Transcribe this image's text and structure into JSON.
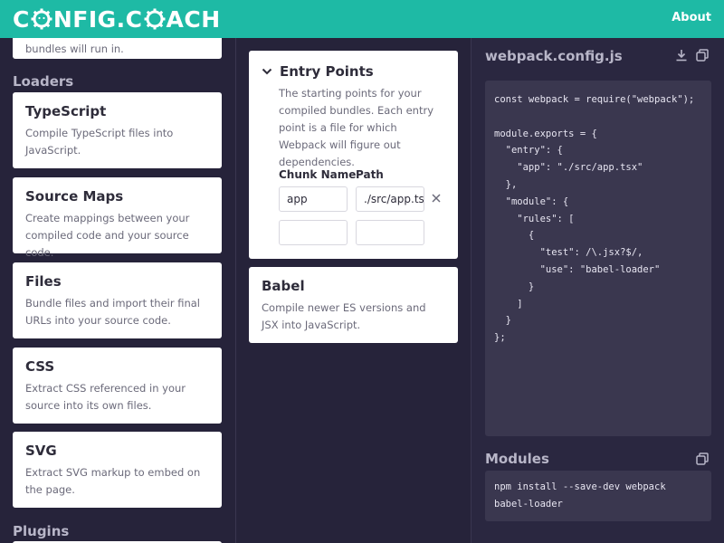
{
  "header": {
    "logo_part1": "C",
    "logo_part2": "NFIG.C",
    "logo_part3": "ACH",
    "about": "About"
  },
  "left": {
    "partial_text": "bundles will run in.",
    "loaders_label": "Loaders",
    "plugins_label": "Plugins",
    "cards": [
      {
        "title": "TypeScript",
        "desc": "Compile TypeScript files into JavaScript."
      },
      {
        "title": "Source Maps",
        "desc": "Create mappings between your compiled code and your source code."
      },
      {
        "title": "Files",
        "desc": "Bundle files and import their final URLs into your source code."
      },
      {
        "title": "CSS",
        "desc": "Extract CSS referenced in your source into its own files."
      },
      {
        "title": "SVG",
        "desc": "Extract SVG markup to embed on the page."
      }
    ]
  },
  "middle": {
    "entry_points": {
      "title": "Entry Points",
      "desc": "The starting points for your compiled bundles. Each entry point is a file for which Webpack will figure out dependencies.",
      "col_chunk": "Chunk Name",
      "col_path": "Path",
      "row1_chunk": "app",
      "row1_path": "./src/app.tsx",
      "row2_chunk": "",
      "row2_path": ""
    },
    "babel": {
      "title": "Babel",
      "desc": "Compile newer ES versions and JSX into JavaScript."
    }
  },
  "right": {
    "config_title": "webpack.config.js",
    "code": "const webpack = require(\"webpack\");\n\nmodule.exports = {\n  \"entry\": {\n    \"app\": \"./src/app.tsx\"\n  },\n  \"module\": {\n    \"rules\": [\n      {\n        \"test\": /\\.jsx?$/,\n        \"use\": \"babel-loader\"\n      }\n    ]\n  }\n};",
    "modules_title": "Modules",
    "modules_cmd": "npm install --save-dev webpack babel-loader",
    "icons": [
      "download-icon",
      "copy-icon"
    ]
  },
  "colors": {
    "header": "#1ebaa5",
    "background": "#26233a",
    "code_bg": "#3a374f"
  }
}
